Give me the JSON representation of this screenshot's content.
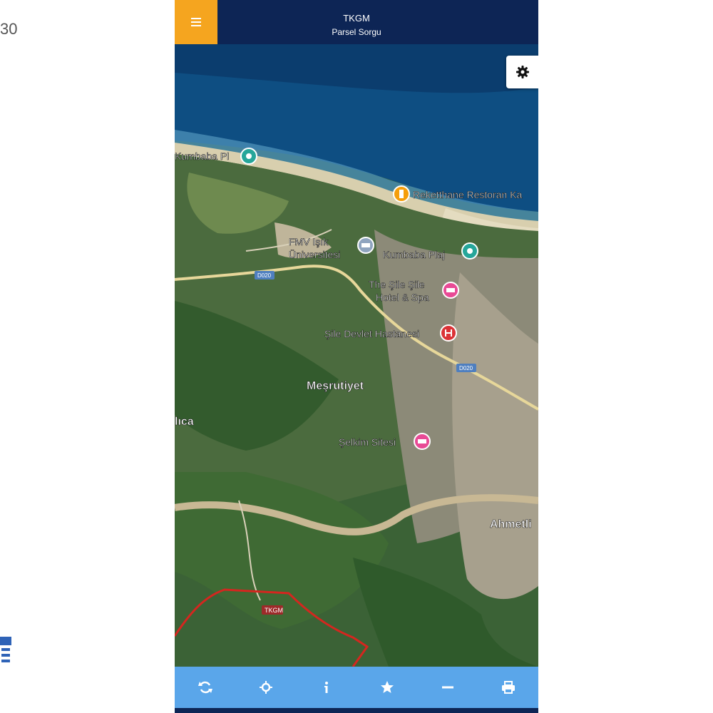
{
  "side": {
    "text": "30"
  },
  "header": {
    "title": "TKGM",
    "subtitle": "Parsel Sorgu"
  },
  "map": {
    "labels": {
      "kumbaba_top": "Kumbaba Pl",
      "restaurant": "Reketthane Restoran Ka",
      "university_1": "FMV Işık",
      "university_2": "Üniversitesi",
      "kumbaba_plaj": "Kumbaba Plaj",
      "hotel_1": "The Şile Şile",
      "hotel_2": "Hotel & Spa",
      "hospital": "Şile Devlet Hastanesi",
      "mesrutiyet": "Meşrutiyet",
      "balibey": "lıca",
      "sitesi": "Şelkim Sitesi",
      "ahmetli": "Ahmetli",
      "road_1": "D020",
      "road_2": "D020",
      "tkgm_mark": "TKGM"
    }
  },
  "toolbar": {
    "icons": [
      "refresh-icon",
      "locate-icon",
      "info-icon",
      "star-icon",
      "minus-icon",
      "print-icon"
    ]
  }
}
